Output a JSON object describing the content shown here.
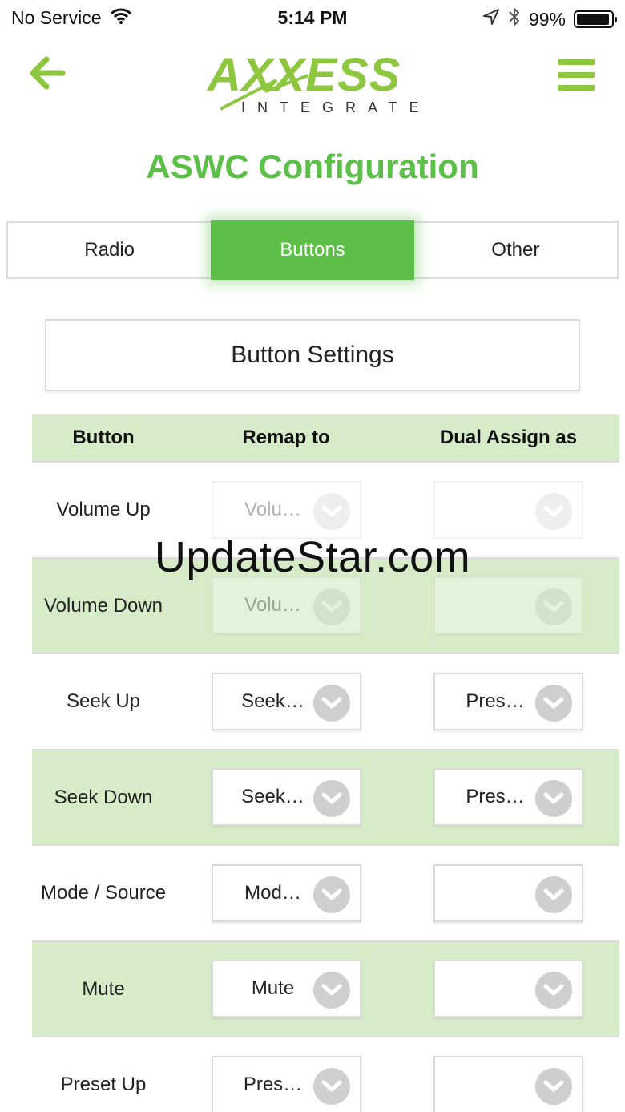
{
  "status_bar": {
    "carrier": "No Service",
    "time": "5:14 PM",
    "battery": "99%"
  },
  "header": {
    "logo_text": "AXXESS",
    "logo_subtext": "INTEGRATE",
    "title": "ASWC Configuration"
  },
  "tabs": [
    {
      "label": "Radio",
      "active": false
    },
    {
      "label": "Buttons",
      "active": true
    },
    {
      "label": "Other",
      "active": false
    }
  ],
  "settings_button_label": "Button Settings",
  "table": {
    "columns": [
      "Button",
      "Remap to",
      "Dual Assign as"
    ],
    "rows": [
      {
        "button": "Volume Up",
        "remap": "Volu…",
        "dual": "",
        "disabled": true
      },
      {
        "button": "Volume Down",
        "remap": "Volu…",
        "dual": "",
        "disabled": true
      },
      {
        "button": "Seek Up",
        "remap": "Seek…",
        "dual": "Pres…",
        "disabled": false
      },
      {
        "button": "Seek Down",
        "remap": "Seek…",
        "dual": "Pres…",
        "disabled": false
      },
      {
        "button": "Mode / Source",
        "remap": "Mod…",
        "dual": "",
        "disabled": false
      },
      {
        "button": "Mute",
        "remap": "Mute",
        "dual": "",
        "disabled": false
      },
      {
        "button": "Preset Up",
        "remap": "Pres…",
        "dual": "",
        "disabled": false
      }
    ]
  },
  "watermark": "UpdateStar.com",
  "colors": {
    "brand_green": "#8dc63f",
    "active_tab": "#5cbf47",
    "row_shade": "#d6ecc8"
  }
}
